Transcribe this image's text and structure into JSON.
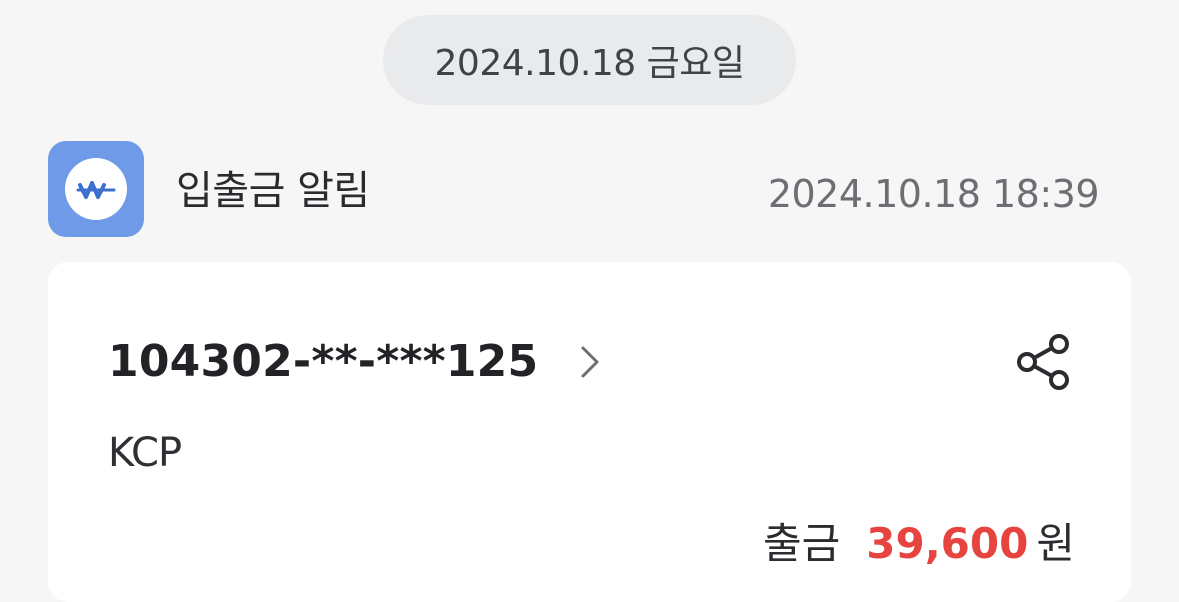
{
  "date_separator": "2024.10.18 금요일",
  "sender": {
    "name": "입출금 알림",
    "icon": "won-sign-icon",
    "icon_color": "#6f9ae8"
  },
  "message_time": "2024.10.18 18:39",
  "notification": {
    "account_number": "104302-**-***125",
    "merchant": "KCP",
    "transaction_type": "출금",
    "amount": "39,600",
    "currency_unit": "원",
    "amount_color": "#e8443f"
  }
}
